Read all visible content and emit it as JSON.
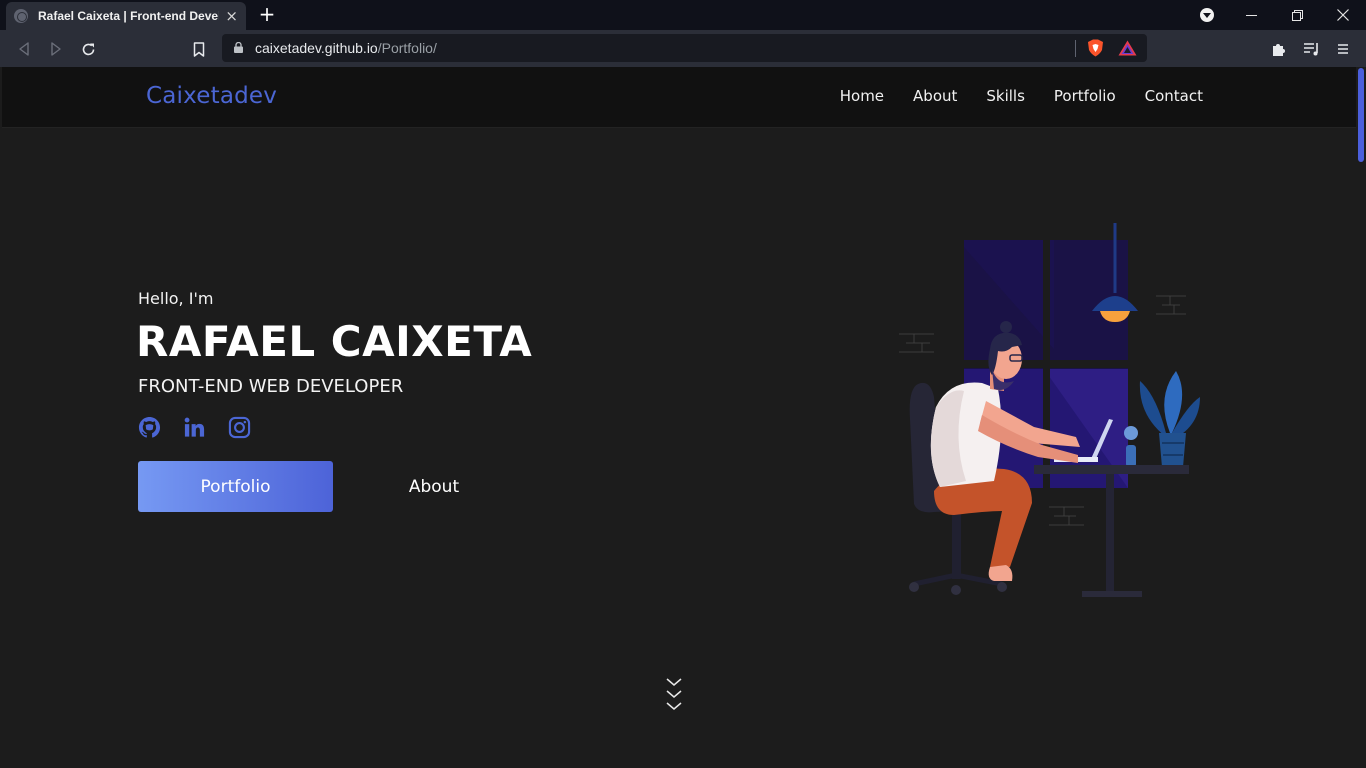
{
  "browser": {
    "tab_title": "Rafael Caixeta | Front-end Developer",
    "tab_close": "×",
    "new_tab": "+",
    "url_host": "caixetadev.github.io",
    "url_path": "/Portfolio/"
  },
  "site": {
    "logo": "Caixetadev",
    "nav": [
      "Home",
      "About",
      "Skills",
      "Portfolio",
      "Contact"
    ]
  },
  "hero": {
    "greeting": "Hello, I'm",
    "name": "RAFAEL CAIXETA",
    "role": "FRONT-END WEB DEVELOPER",
    "socials": [
      "github-icon",
      "linkedin-icon",
      "instagram-icon"
    ],
    "primary_button": "Portfolio",
    "secondary_button": "About"
  },
  "colors": {
    "accent": "#4b66d4",
    "button_gradient_start": "#7699f3",
    "button_gradient_end": "#4d63d8",
    "page_background": "#1c1c1c",
    "header_background": "#111111"
  }
}
